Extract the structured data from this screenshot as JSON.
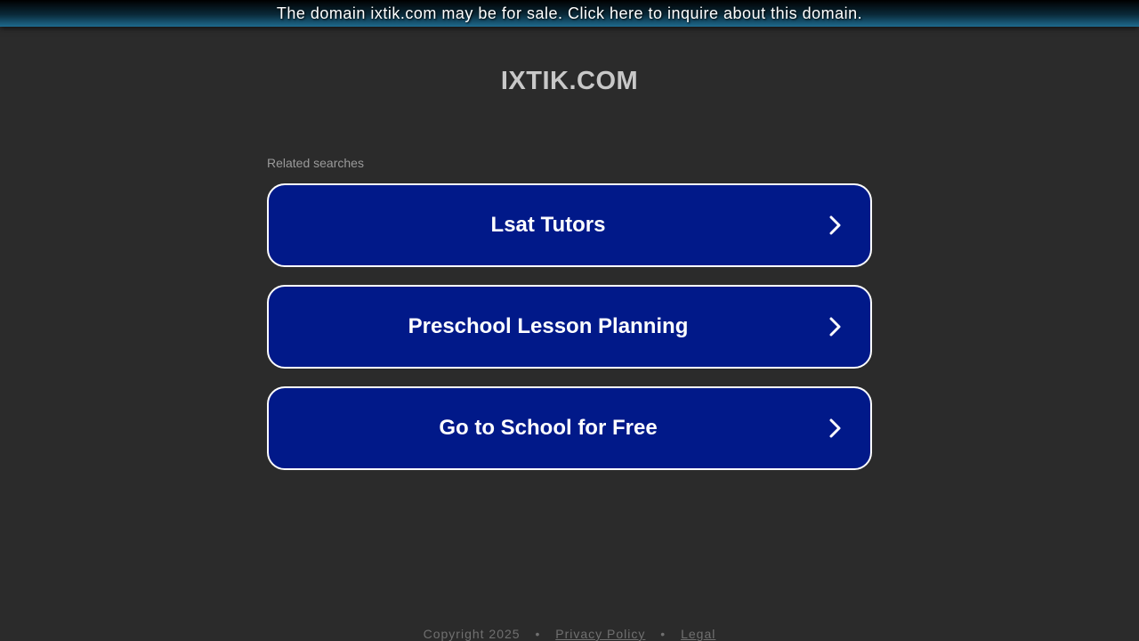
{
  "banner": {
    "text": "The domain ixtik.com may be for sale. Click here to inquire about this domain."
  },
  "site": {
    "title": "IXTIK.COM"
  },
  "related": {
    "label": "Related searches",
    "items": [
      {
        "label": "Lsat Tutors",
        "icon": "chevron-right-icon"
      },
      {
        "label": "Preschool Lesson Planning",
        "icon": "chevron-right-icon"
      },
      {
        "label": "Go to School for Free",
        "icon": "chevron-right-icon"
      }
    ]
  },
  "footer": {
    "copyright": "Copyright 2025",
    "separator": "•",
    "privacy": "Privacy Policy",
    "legal": "Legal"
  },
  "colors": {
    "background": "#2b2b2b",
    "button": "#011989",
    "button_border": "#ffffff",
    "title": "#c8c8c8"
  }
}
